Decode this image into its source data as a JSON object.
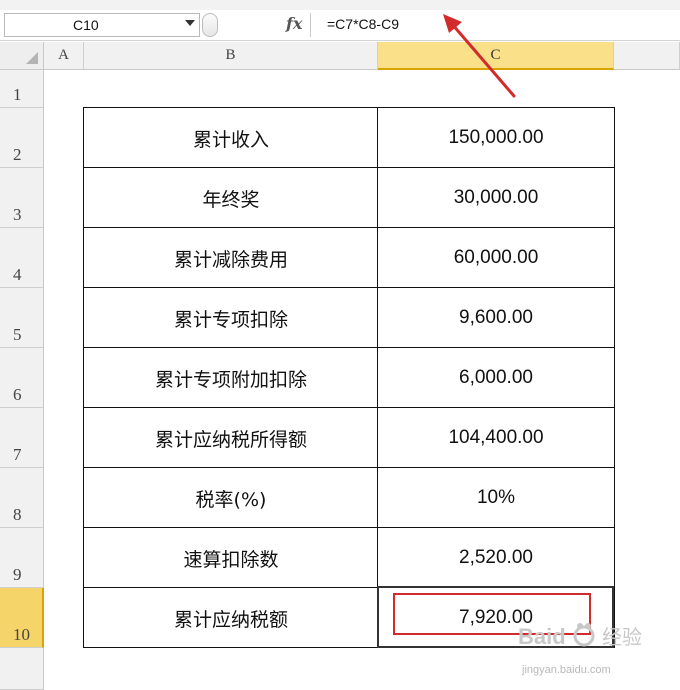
{
  "formula_bar": {
    "name_box": "C10",
    "fx_icon": "fx",
    "formula": "=C7*C8-C9"
  },
  "column_headers": [
    "A",
    "B",
    "C"
  ],
  "row_headers": [
    "1",
    "2",
    "3",
    "4",
    "5",
    "6",
    "7",
    "8",
    "9",
    "10"
  ],
  "selected": {
    "column": "C",
    "row": "10",
    "cell": "C10"
  },
  "table": {
    "rows": [
      {
        "label": "累计收入",
        "value": "150,000.00"
      },
      {
        "label": "年终奖",
        "value": "30,000.00"
      },
      {
        "label": "累计减除费用",
        "value": "60,000.00"
      },
      {
        "label": "累计专项扣除",
        "value": "9,600.00"
      },
      {
        "label": "累计专项附加扣除",
        "value": "6,000.00"
      },
      {
        "label": "累计应纳税所得额",
        "value": "104,400.00"
      },
      {
        "label": "税率(%)",
        "value": "10%"
      },
      {
        "label": "速算扣除数",
        "value": "2,520.00"
      },
      {
        "label": "累计应纳税额",
        "value": "7,920.00"
      }
    ]
  },
  "annotation": {
    "arrow_color": "#d22b2b",
    "box_color": "#d22b2b"
  },
  "watermark": {
    "url": "jingyan.baidu.com"
  },
  "colors": {
    "selected_header": "#fbe08a",
    "header_bg": "#f1f1f1"
  }
}
